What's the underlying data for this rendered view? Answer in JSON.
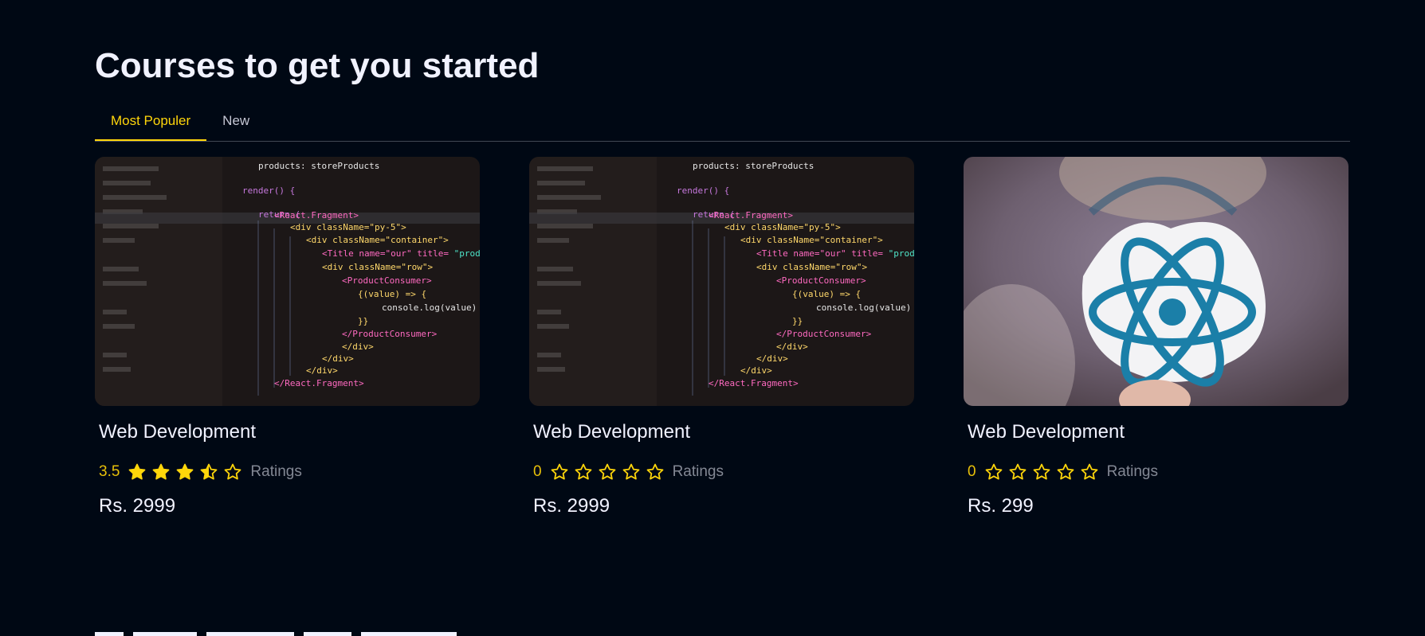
{
  "section": {
    "title": "Courses to get you started"
  },
  "tabs": [
    {
      "label": "Most Populer",
      "active": true
    },
    {
      "label": "New",
      "active": false
    }
  ],
  "courses": [
    {
      "title": "Web Development",
      "rating": "3.5",
      "rating_value": 3.5,
      "ratings_label": "Ratings",
      "price": "Rs. 2999",
      "thumbnail": "code-editor-image"
    },
    {
      "title": "Web Development",
      "rating": "0",
      "rating_value": 0,
      "ratings_label": "Ratings",
      "price": "Rs. 2999",
      "thumbnail": "code-editor-image"
    },
    {
      "title": "Web Development",
      "rating": "0",
      "rating_value": 0,
      "ratings_label": "Ratings",
      "price": "Rs. 299",
      "thumbnail": "react-logo-sticker-image"
    }
  ],
  "colors": {
    "background": "#000814",
    "accent": "#ffd60a",
    "star": "#ffd60a",
    "muted": "#838894",
    "text": "#f1f2ff"
  },
  "icons": [
    "star-full-icon",
    "star-half-icon",
    "star-empty-icon"
  ]
}
